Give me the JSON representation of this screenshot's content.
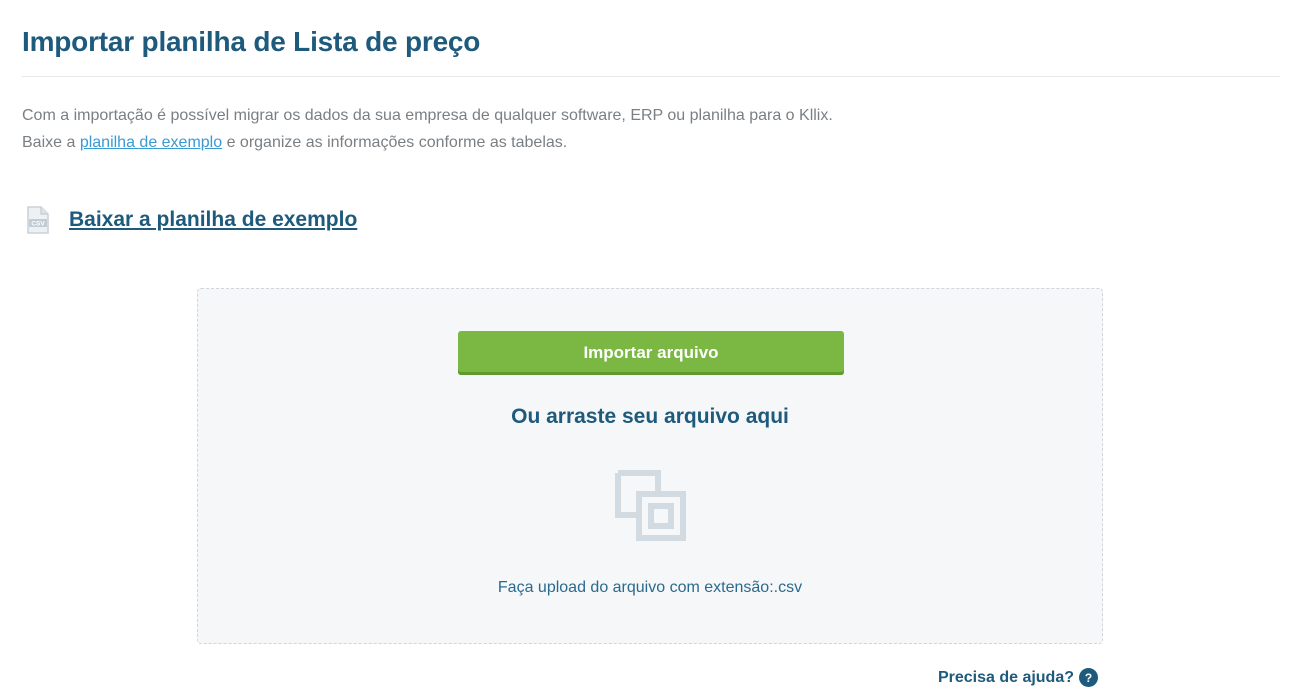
{
  "page": {
    "title": "Importar planilha de Lista de preço"
  },
  "intro": {
    "line1": "Com a importação é possível migrar os dados da sua empresa de qualquer software, ERP ou planilha para o Kllix.",
    "line2_prefix": "Baixe a ",
    "line2_link": "planilha de exemplo",
    "line2_suffix": " e organize as informações conforme as tabelas."
  },
  "download": {
    "icon": "csv-file-icon",
    "icon_label": "CSV",
    "link_label": "Baixar a planilha de exemplo"
  },
  "dropzone": {
    "button_label": "Importar arquivo",
    "drag_text": "Ou arraste seu arquivo aqui",
    "icon": "drag-drop-icon",
    "hint": "Faça upload do arquivo com extensão:.csv"
  },
  "help": {
    "label": "Precisa de ajuda?",
    "icon_glyph": "?"
  },
  "colors": {
    "title": "#1e5a7c",
    "link": "#3a9ad4",
    "button": "#7ab843",
    "dropzone_bg": "#f5f7f9"
  }
}
